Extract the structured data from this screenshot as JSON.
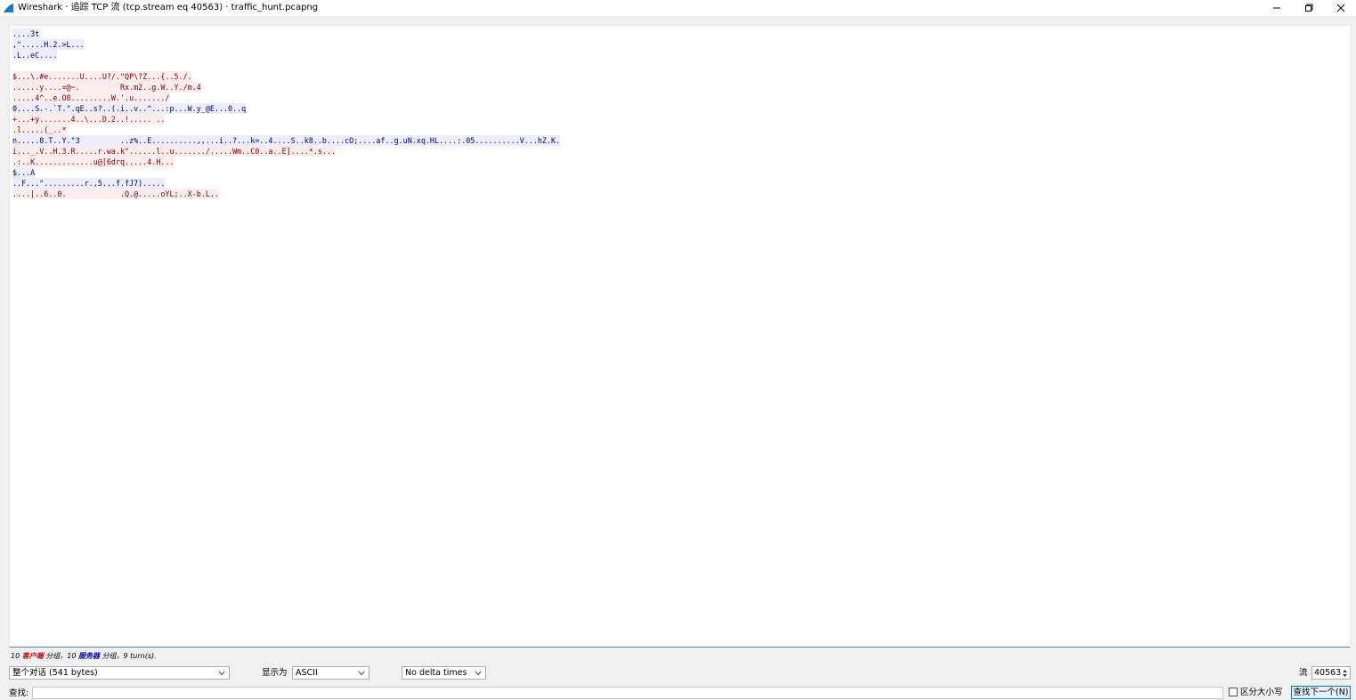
{
  "window": {
    "title": "Wireshark · 追踪 TCP 流 (tcp.stream eq 40563) · traffic_hunt.pcapng",
    "icon": "wireshark-fin-icon",
    "controls": {
      "minimize": "minimize-icon",
      "maximize": "restore-icon",
      "close": "close-icon"
    }
  },
  "colors": {
    "client_bg": "#fbeded",
    "client_fg": "#7f0000",
    "server_bg": "#ededfb",
    "server_fg": "#00007f",
    "accent": "#0078d7"
  },
  "stream": {
    "lines": [
      {
        "dir": "server",
        "text": "....3t"
      },
      {
        "dir": "server",
        "text": ",\".....H.2.>L..."
      },
      {
        "dir": "server",
        "text": ".L..eC...."
      },
      {
        "dir": "blank",
        "text": ""
      },
      {
        "dir": "client",
        "text": "$...\\.#e.......U....U?/.\"QP\\?Z...{..5./."
      },
      {
        "dir": "client",
        "text": "......y....=@~.         Rx.m2..g.W..Y./m.4"
      },
      {
        "dir": "client",
        "text": ".....4^..e.O8.........W.'.u......./"
      },
      {
        "dir": "server",
        "text": "0....S.-.`T.\".qE..s?..(.i..v..^...:p...W.y_@E...0..q"
      },
      {
        "dir": "client",
        "text": "+...+y.......4..\\...D.2..!..... .."
      },
      {
        "dir": "client",
        "text": ".l.....(_..*"
      },
      {
        "dir": "server",
        "text": "n.....8.T..Y.\"3         ..z%..E..........,,...i..?...k=..4....S..k8..b....cO;....af..g.uN.xq.HL....:.05..........V...hZ.K."
      },
      {
        "dir": "client",
        "text": "i..._.V..H.3.R.....r.wa.k\"......l..u......./.....Wm..C0..a..E]....*.s..."
      },
      {
        "dir": "client",
        "text": ".:..K.............u@[6drq.....4.H..."
      },
      {
        "dir": "server",
        "text": "$...A"
      },
      {
        "dir": "server",
        "text": "..F...\".........r.,5...f.fJ7)....."
      },
      {
        "dir": "client",
        "text": "....|..6..0.            .Q.@.....oYL;..X-b.L.."
      }
    ]
  },
  "summary": {
    "prefix": "10 ",
    "client": "客户端",
    "mid": " 分组，10 ",
    "server": "服务器",
    "suffix": " 分组，9 turn(s)."
  },
  "controls": {
    "conversation": "整个对话 (541 bytes)",
    "show_as_label": "显示为",
    "show_as": "ASCII",
    "delta": "No delta times",
    "stream_label": "流",
    "stream_number": "40563"
  },
  "find": {
    "label": "查找:",
    "value": "",
    "case_label": "区分大小写",
    "next_button": "查找下一个(N)"
  }
}
